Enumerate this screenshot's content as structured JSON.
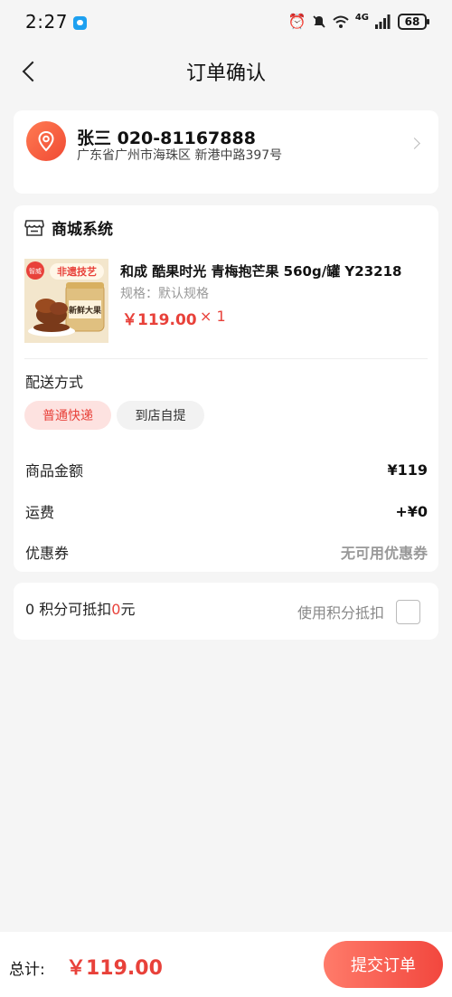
{
  "status_bar": {
    "time": "2:27",
    "network": "4G",
    "battery": "68",
    "icons": [
      "chat-app-icon",
      "alarm-icon",
      "mute-icon",
      "wifi-icon",
      "signal-icon",
      "battery-icon"
    ]
  },
  "nav": {
    "title": "订单确认",
    "back_icon": "chevron-left-icon"
  },
  "address": {
    "name_phone": "张三 020-81167888",
    "detail": "广东省广州市海珠区 新港中路397号",
    "icon": "location-pin-icon"
  },
  "shop": {
    "name": "商城系统",
    "icon": "store-icon"
  },
  "product": {
    "name": "和成 酷果时光 青梅抱芒果 560g/罐 Y23218",
    "spec": "规格：默认规格",
    "price": "￥119.00",
    "qty": "× 1",
    "image_text": {
      "brand": "智威",
      "banner": "非遗技艺",
      "jar_label": "新鲜大果"
    }
  },
  "delivery": {
    "label": "配送方式",
    "options": [
      "普通快递",
      "到店自提"
    ],
    "selected": "普通快递"
  },
  "summary": {
    "goods_label": "商品金额",
    "goods_value": "¥119",
    "shipping_label": "运费",
    "shipping_value": "+¥0",
    "coupon_label": "优惠券",
    "coupon_value": "无可用优惠券"
  },
  "points": {
    "prefix": "0 积分可抵扣",
    "amount": "0",
    "suffix": "元",
    "use_label": "使用积分抵扣",
    "checked": false
  },
  "footer": {
    "total_label": "总计:",
    "total_value": "￥119.00",
    "submit_label": "提交订单"
  },
  "colors": {
    "accent": "#e8413a",
    "accent_light": "#fde2e0",
    "background": "#f5f5f5"
  }
}
